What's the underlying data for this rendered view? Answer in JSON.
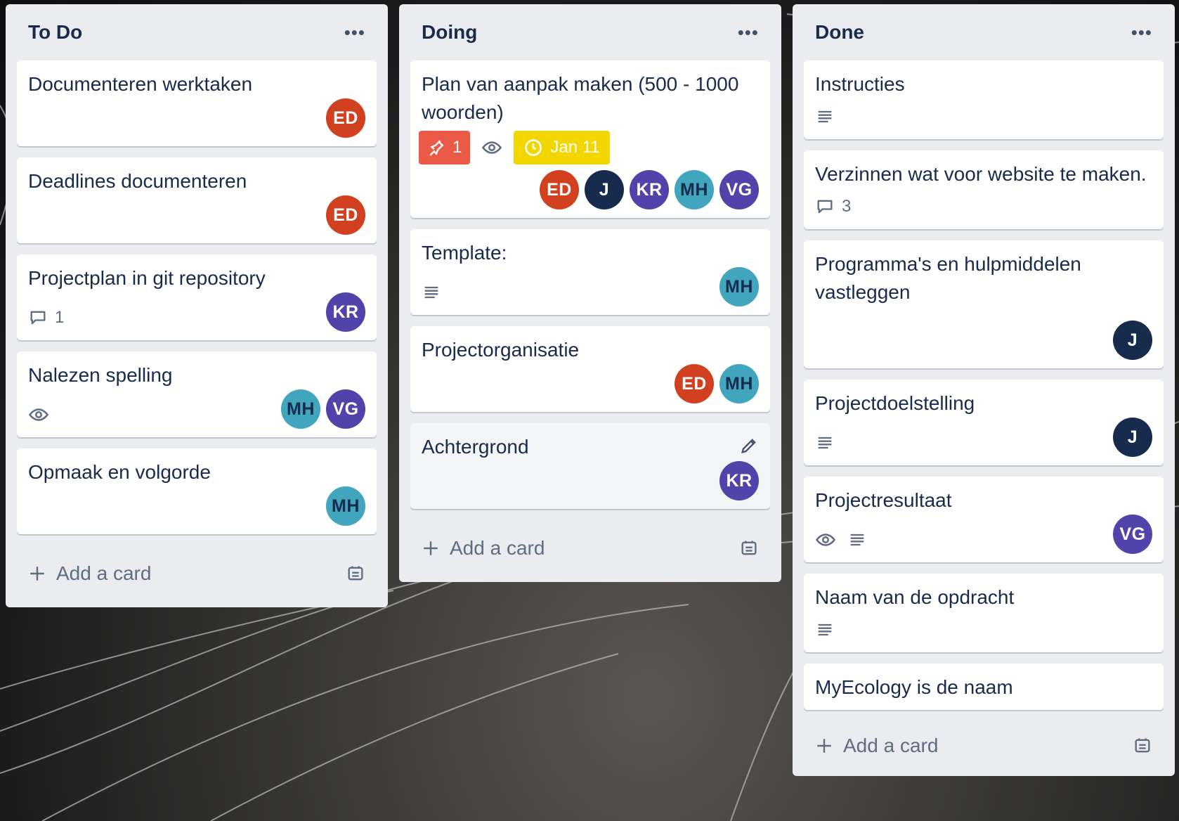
{
  "lists": [
    {
      "title": "To Do",
      "cards": [
        {
          "title": "Documenteren werktaken",
          "members": [
            "ED"
          ]
        },
        {
          "title": "Deadlines documenteren",
          "members": [
            "ED"
          ]
        },
        {
          "title": "Projectplan in git repository",
          "comments": "1",
          "members": [
            "KR"
          ]
        },
        {
          "title": "Nalezen spelling",
          "members": [
            "MH",
            "VG"
          ]
        },
        {
          "title": "Opmaak en volgorde",
          "members": [
            "MH"
          ]
        }
      ],
      "add_card_label": "Add a card"
    },
    {
      "title": "Doing",
      "cards": [
        {
          "title": "Plan van aanpak maken (500 - 1000 woorden)",
          "attachments": "1",
          "due": "Jan 11",
          "members": [
            "ED",
            "J",
            "KR",
            "MH",
            "VG"
          ]
        },
        {
          "title": "Template:",
          "members": [
            "MH"
          ]
        },
        {
          "title": "Projectorganisatie",
          "members": [
            "ED",
            "MH"
          ]
        },
        {
          "title": "Achtergrond",
          "members": [
            "KR"
          ]
        }
      ],
      "add_card_label": "Add a card"
    },
    {
      "title": "Done",
      "cards": [
        {
          "title": "Instructies"
        },
        {
          "title": "Verzinnen wat voor website te maken.",
          "comments": "3"
        },
        {
          "title": "Programma's en hulpmiddelen vastleggen",
          "members": [
            "J"
          ]
        },
        {
          "title": "Projectdoelstelling",
          "members": [
            "J"
          ]
        },
        {
          "title": "Projectresultaat",
          "members": [
            "VG"
          ]
        },
        {
          "title": "Naam van de opdracht"
        },
        {
          "title": "MyEcology is de naam"
        }
      ],
      "add_card_label": "Add a card"
    }
  ],
  "colors": {
    "list_bg": "#ebecf0",
    "card_bg": "#ffffff",
    "text": "#172b4d",
    "muted": "#5e6c84",
    "avatar_ED": "#d1401f",
    "avatar_J": "#172b4d",
    "avatar_KR": "#5243aa",
    "avatar_MH": "#40a5bd",
    "avatar_VG": "#5243aa",
    "badge_red": "#eb5a46",
    "badge_yellow": "#f2d600"
  },
  "icons": [
    "more-icon",
    "comment-icon",
    "eye-icon",
    "description-icon",
    "attachment-icon",
    "clock-icon",
    "pencil-icon",
    "plus-icon",
    "template-icon"
  ]
}
